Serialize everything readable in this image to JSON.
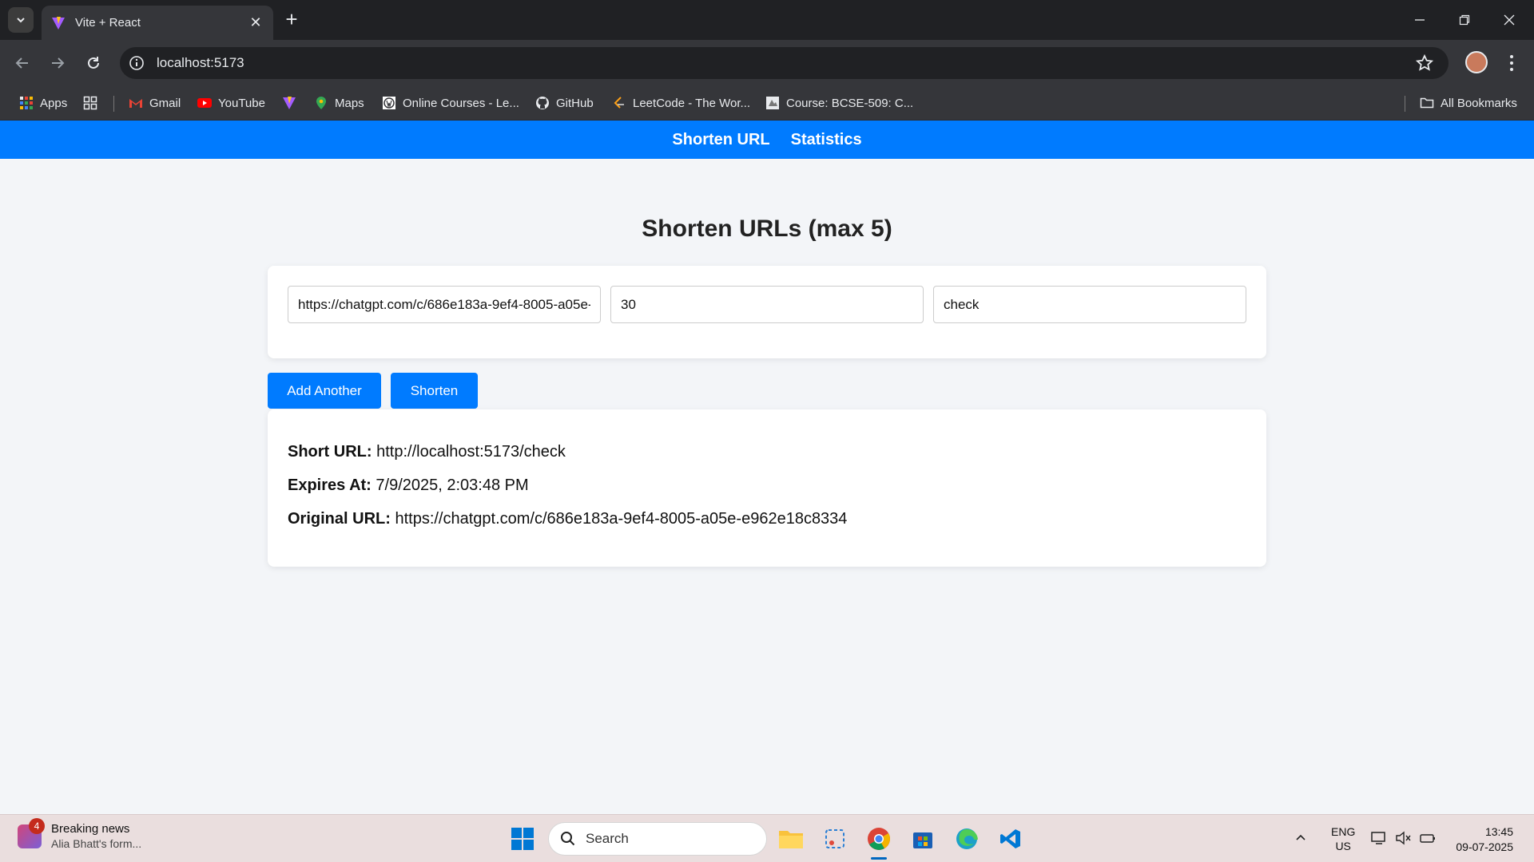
{
  "browser": {
    "tab": {
      "title": "Vite + React"
    },
    "omnibox": {
      "url": "localhost:5173"
    },
    "bookmarks": [
      {
        "label": "Apps",
        "icon": "apps-grid-icon"
      },
      {
        "label": "",
        "icon": "tab-groups-icon"
      },
      {
        "label": "Gmail",
        "icon": "gmail-icon"
      },
      {
        "label": "YouTube",
        "icon": "youtube-icon"
      },
      {
        "label": "",
        "icon": "vite-icon"
      },
      {
        "label": "Maps",
        "icon": "maps-icon"
      },
      {
        "label": "Online Courses - Le...",
        "icon": "wordpress-icon"
      },
      {
        "label": "GitHub",
        "icon": "github-icon"
      },
      {
        "label": "LeetCode - The Wor...",
        "icon": "leetcode-icon"
      },
      {
        "label": "Course: BCSE-509: C...",
        "icon": "course-icon"
      }
    ],
    "all_bookmarks": "All Bookmarks"
  },
  "app": {
    "nav": {
      "shorten": "Shorten URL",
      "stats": "Statistics"
    },
    "title": "Shorten URLs (max 5)",
    "form": {
      "url_value": "https://chatgpt.com/c/686e183a-9ef4-8005-a05e-e962e18c8334",
      "validity_value": "30",
      "shortcode_value": "check"
    },
    "buttons": {
      "add": "Add Another",
      "shorten": "Shorten"
    },
    "result": {
      "short_label": "Short URL:",
      "short_value": "http://localhost:5173/check",
      "expires_label": "Expires At:",
      "expires_value": "7/9/2025, 2:03:48 PM",
      "original_label": "Original URL:",
      "original_value": "https://chatgpt.com/c/686e183a-9ef4-8005-a05e-e962e18c8334"
    },
    "colors": {
      "primary": "#007bff",
      "background": "#f3f5f8"
    }
  },
  "taskbar": {
    "news_badge": "4",
    "news_title": "Breaking news",
    "news_sub": "Alia Bhatt's form...",
    "search": "Search",
    "lang_1": "ENG",
    "lang_2": "US",
    "time": "13:45",
    "date": "09-07-2025"
  }
}
